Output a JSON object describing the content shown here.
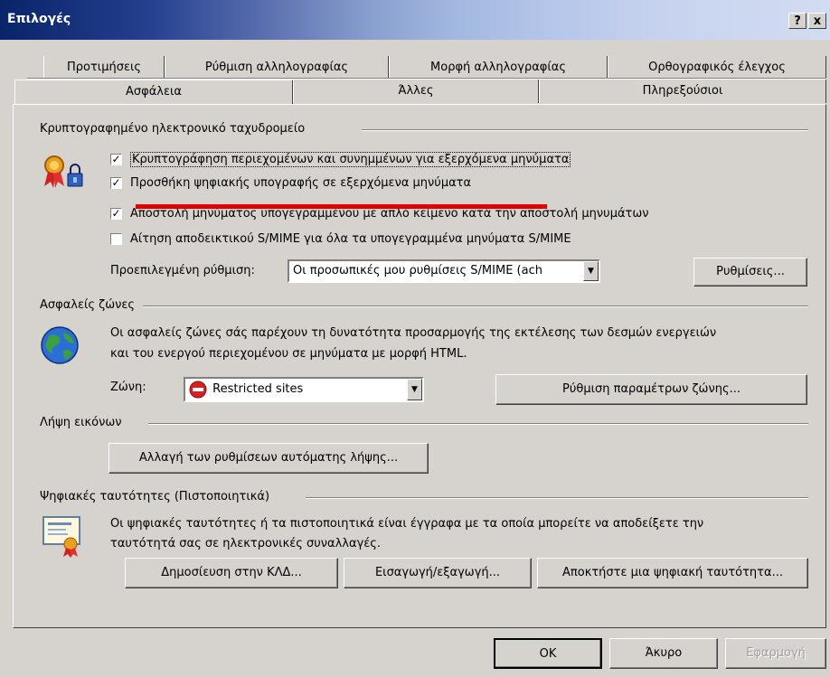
{
  "window": {
    "title": "Επιλογές",
    "help_label": "?",
    "close_label": "x"
  },
  "tabs": {
    "back": [
      "Προτιμήσεις",
      "Ρύθμιση αλληλογραφίας",
      "Μορφή αλληλογραφίας",
      "Ορθογραφικός έλεγχος"
    ],
    "front": [
      "Ασφάλεια",
      "Άλλες",
      "Πληρεξούσιοι"
    ],
    "active": "Ασφάλεια"
  },
  "encrypted_mail": {
    "title": "Κρυπτογραφημένο ηλεκτρονικό ταχυδρομείο",
    "options": [
      {
        "label": "Κρυπτογράφηση περιεχομένων και συνημμένων για εξερχόμενα μηνύματα",
        "checked": true
      },
      {
        "label": "Προσθήκη ψηφιακής υπογραφής σε εξερχόμενα μηνύματα",
        "checked": true
      },
      {
        "label": "Αποστολή μηνύματος υπογεγραμμένου με απλό κείμενο κατά την αποστολή μηνυμάτων",
        "checked": true
      },
      {
        "label": "Αίτηση αποδεικτικού S/MIME για όλα τα υπογεγραμμένα μηνύματα S/MIME",
        "checked": false
      }
    ],
    "default_setting_label": "Προεπιλεγμένη ρύθμιση:",
    "default_setting_value": "Οι προσωπικές μου ρυθμίσεις S/MIME (ach",
    "settings_button": "Ρυθμίσεις..."
  },
  "secure_zones": {
    "title": "Ασφαλείς ζώνες",
    "description_line1": "Οι ασφαλείς ζώνες σάς παρέχουν τη δυνατότητα προσαρμογής της εκτέλεσης των δεσμών ενεργειών",
    "description_line2": "και του ενεργού περιεχομένου σε μηνύματα με μορφή HTML.",
    "zone_label": "Ζώνη:",
    "zone_value": "Restricted sites",
    "zone_settings_button": "Ρύθμιση παραμέτρων ζώνης..."
  },
  "image_download": {
    "title": "Λήψη εικόνων",
    "change_button": "Αλλαγή των ρυθμίσεων αυτόματης λήψης..."
  },
  "digital_ids": {
    "title": "Ψηφιακές ταυτότητες (Πιστοποιητικά)",
    "description_line1": "Οι ψηφιακές ταυτότητες ή τα πιστοποιητικά είναι έγγραφα με τα οποία μπορείτε να αποδείξετε την",
    "description_line2": "ταυτότητά σας σε ηλεκτρονικές συναλλαγές.",
    "publish_button": "Δημοσίευση στην ΚΛΔ...",
    "import_export_button": "Εισαγωγή/εξαγωγή...",
    "get_id_button": "Αποκτήστε μια ψηφιακή ταυτότητα..."
  },
  "footer": {
    "ok": "OK",
    "cancel": "Άκυρο",
    "apply": "Εφαρμογή"
  },
  "colors": {
    "annotation_line": "#e00000",
    "titlebar_start": "#0a246a",
    "dialog_bg": "#d6d3ce"
  }
}
